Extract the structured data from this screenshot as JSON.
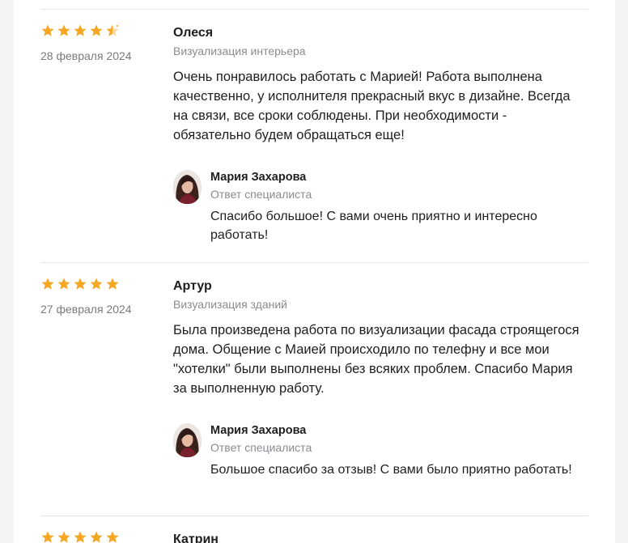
{
  "reviews": [
    {
      "rating": 4.5,
      "author": "Олеся",
      "date": "28 февраля 2024",
      "category": "Визуализация интерьера",
      "text": "Очень понравилось работать с Марией! Работа выполнена качественно, у исполнителя прекрасный вкус в дизайне. Всегда на связи, все сроки соблюдены. При необходимости - обязательно будем обращаться еще!",
      "reply": {
        "name": "Мария Захарова",
        "role": "Ответ специалиста",
        "text": "Спасибо большое! С вами очень приятно и интересно работать!"
      }
    },
    {
      "rating": 5,
      "author": "Артур",
      "date": "27 февраля 2024",
      "category": "Визуализация зданий",
      "text": "Была произведена работа по визуализации фасада строящегося дома. Общение с Маией происходило по телефну и все мои \"хотелки\" были выполнены без всяких проблем. Спасибо Мария за выполненную работу.",
      "reply": {
        "name": "Мария Захарова",
        "role": "Ответ специалиста",
        "text": "Большое спасибо за отзыв! С вами было приятно работать!"
      }
    },
    {
      "rating": 5,
      "author": "Катрин"
    }
  ],
  "colors": {
    "star": "#f5a623",
    "divider": "#e4e4e6"
  }
}
